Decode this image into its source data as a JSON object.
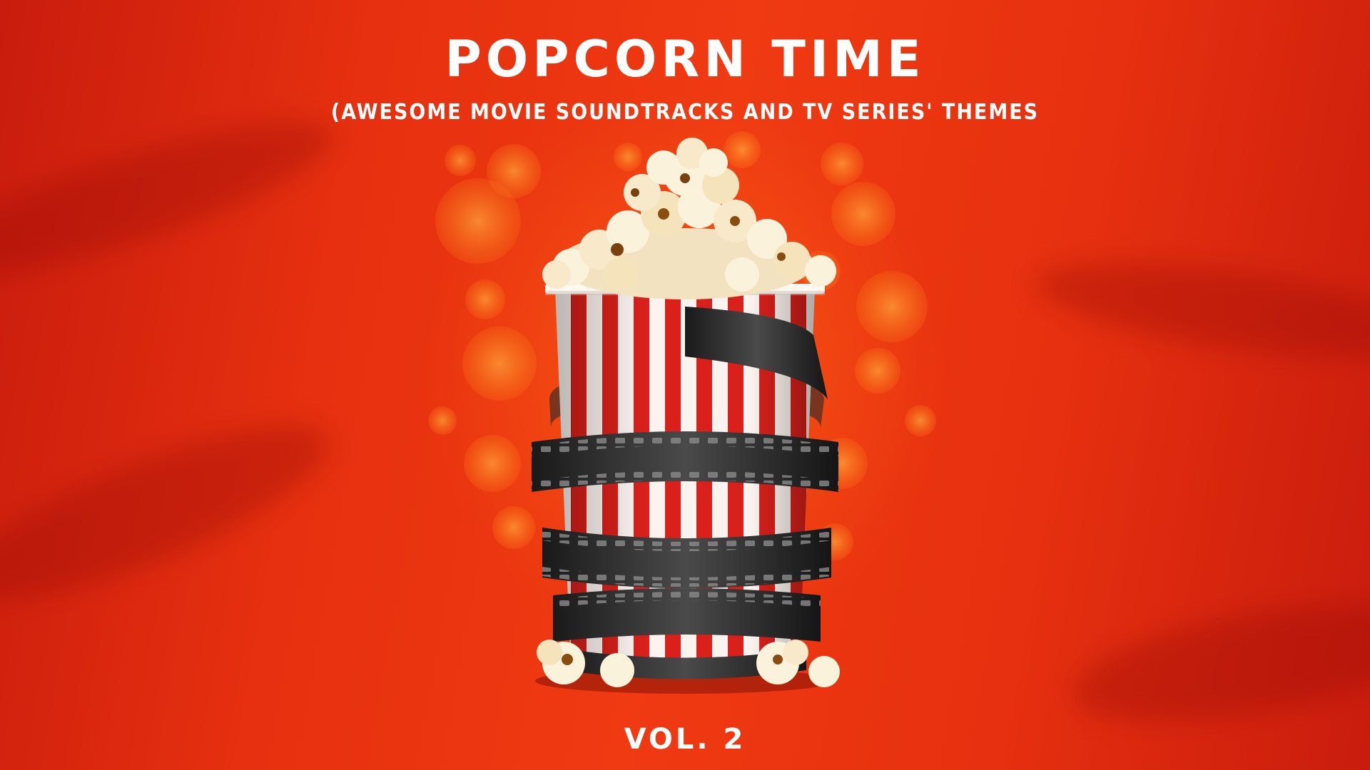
{
  "cover": {
    "title": "POPCORN TIME",
    "subtitle": "(AWESOME MOVIE SOUNDTRACKS AND TV SERIES' THEMES",
    "volume": "VOL. 2"
  },
  "colors": {
    "background": "#e02a10",
    "stripe_red": "#d9201a",
    "stripe_white": "#fbf3ef",
    "film_dark": "#262626",
    "popcorn": "#f6ead0",
    "bokeh": "#ff9a2a"
  },
  "icons": [
    "popcorn-bucket",
    "film-reel",
    "popcorn-kernel"
  ]
}
